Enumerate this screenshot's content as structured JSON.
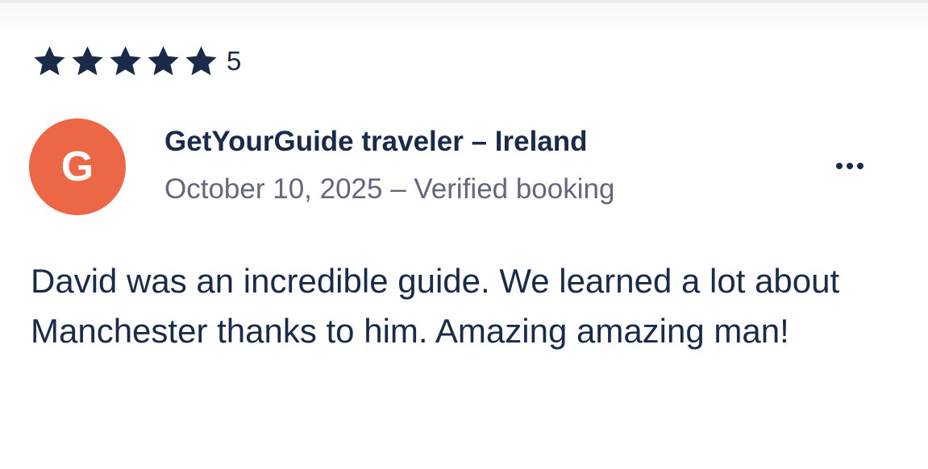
{
  "review": {
    "rating": {
      "stars_filled": 5,
      "stars_total": 5,
      "value_label": "5",
      "star_color": "#1a2b49"
    },
    "avatar": {
      "initial": "G",
      "color": "#eb6745"
    },
    "reviewer_name": "GetYourGuide traveler – Ireland",
    "meta": "October 10, 2025 – Verified booking",
    "more_icon": "more-horizontal-icon",
    "text": "David was an incredible guide. We learned a lot about Manchester thanks to him. Amazing amazing man!"
  }
}
